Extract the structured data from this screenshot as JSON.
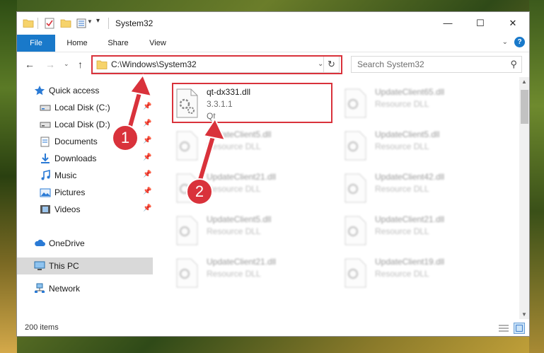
{
  "window": {
    "title": "System32"
  },
  "ribbon": {
    "tabs": [
      "File",
      "Home",
      "Share",
      "View"
    ]
  },
  "address": {
    "path": "C:\\Windows\\System32"
  },
  "search": {
    "placeholder": "Search System32"
  },
  "sidebar": {
    "items": [
      {
        "label": "Quick access",
        "icon": "star-icon"
      },
      {
        "label": "Local Disk (C:)",
        "icon": "drive-icon"
      },
      {
        "label": "Local Disk (D:)",
        "icon": "drive-icon"
      },
      {
        "label": "Documents",
        "icon": "documents-icon"
      },
      {
        "label": "Downloads",
        "icon": "downloads-icon"
      },
      {
        "label": "Music",
        "icon": "music-icon"
      },
      {
        "label": "Pictures",
        "icon": "pictures-icon"
      },
      {
        "label": "Videos",
        "icon": "videos-icon"
      },
      {
        "label": "OneDrive",
        "icon": "cloud-icon"
      },
      {
        "label": "This PC",
        "icon": "computer-icon"
      },
      {
        "label": "Network",
        "icon": "network-icon"
      }
    ]
  },
  "files": [
    {
      "name": "qt-dx331.dll",
      "version": "3.3.1.1",
      "description": "Qt"
    },
    {
      "name": "UpdateClient65.dll",
      "description": "Resource DLL"
    },
    {
      "name": "UpdateClient5.dll",
      "description": "Resource DLL"
    },
    {
      "name": "UpdateClient5.dll",
      "description": "Resource DLL"
    },
    {
      "name": "UpdateClient21.dll",
      "description": "Resource DLL"
    },
    {
      "name": "UpdateClient42.dll",
      "description": "Resource DLL"
    },
    {
      "name": "UpdateClient5.dll",
      "description": "Resource DLL"
    },
    {
      "name": "UpdateClient21.dll",
      "description": "Resource DLL"
    },
    {
      "name": "UpdateClient21.dll",
      "description": "Resource DLL"
    },
    {
      "name": "UpdateClient19.dll",
      "description": "Resource DLL"
    }
  ],
  "status": {
    "item_count": "200 items"
  },
  "annotations": {
    "step1": "1",
    "step2": "2"
  },
  "colors": {
    "accent": "#1979ca",
    "highlight": "#d9323b"
  }
}
